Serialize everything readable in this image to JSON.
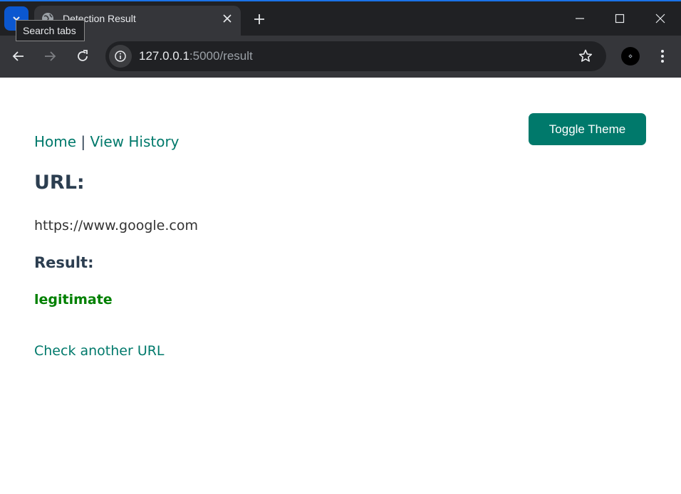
{
  "browser": {
    "tab_title": "Detection Result",
    "tooltip": "Search tabs",
    "url_host": "127.0.0.1",
    "url_path": ":5000/result",
    "icons": {
      "search_tabs": "chevron-down-icon",
      "favicon": "globe-icon",
      "tab_close": "close-icon",
      "new_tab": "plus-icon",
      "back": "arrow-left-icon",
      "forward": "arrow-right-icon",
      "reload": "reload-icon",
      "site_info": "info-icon",
      "bookmark": "star-icon",
      "profile": "avatar-icon",
      "menu": "kebab-menu-icon",
      "minimize": "minimize-icon",
      "maximize": "maximize-icon",
      "close": "window-close-icon"
    }
  },
  "page": {
    "toggle_theme": "Toggle Theme",
    "nav": {
      "home": "Home",
      "separator": "|",
      "history": "View History"
    },
    "url_heading": "URL:",
    "url_value": "https://www.google.com",
    "result_heading": "Result:",
    "result_value": "legitimate",
    "check_another": "Check another URL"
  },
  "colors": {
    "accent": "#00796b",
    "heading": "#2c3e50",
    "legitimate": "#008000",
    "chrome_dark": "#202124",
    "chrome_toolbar": "#35363a"
  }
}
